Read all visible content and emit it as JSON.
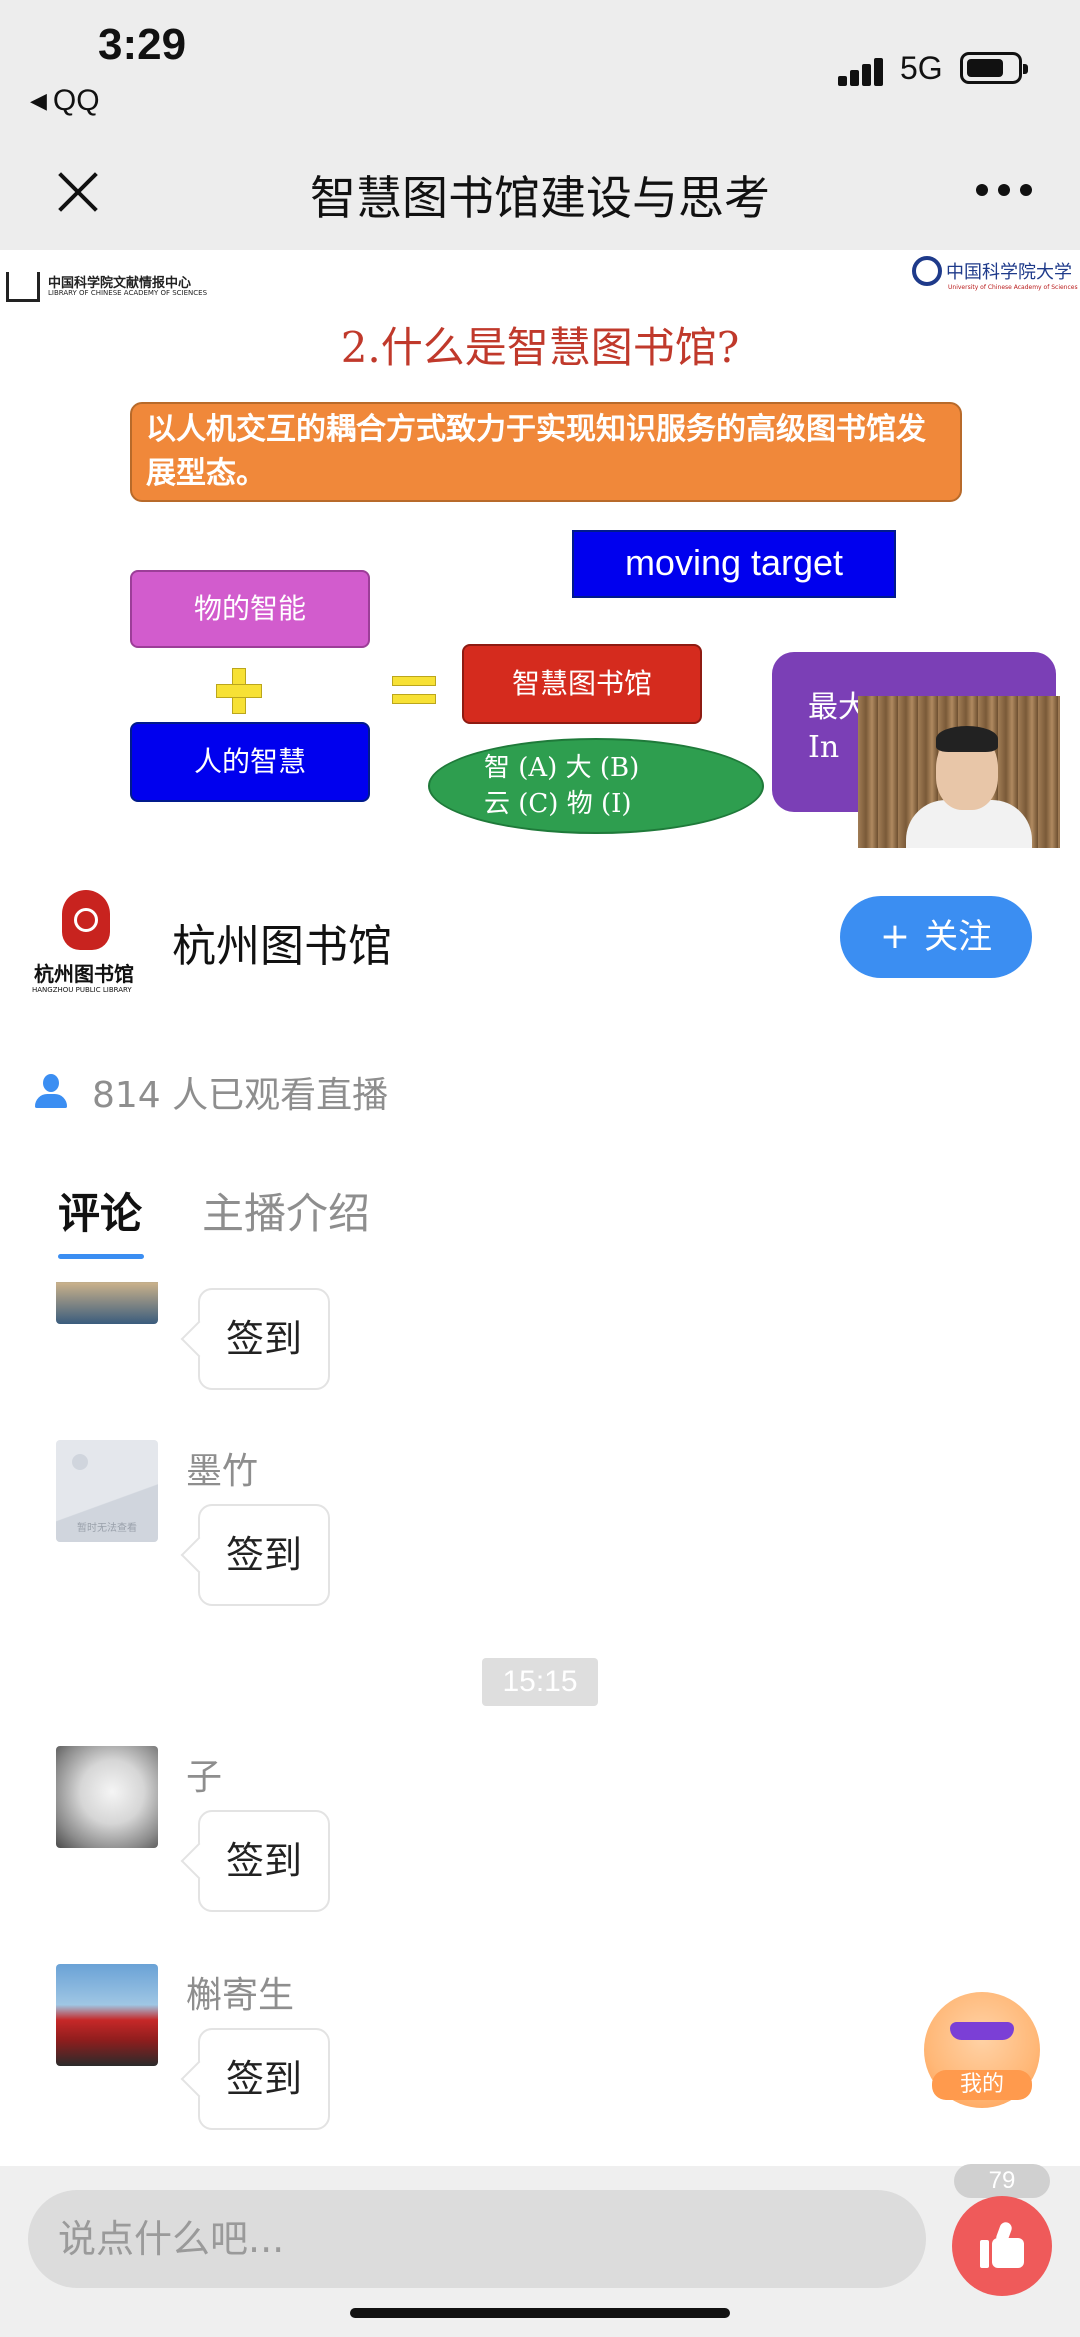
{
  "status_bar": {
    "time": "3:29",
    "back_app": "QQ",
    "network": "5G"
  },
  "nav": {
    "title": "智慧图书馆建设与思考"
  },
  "slide": {
    "logo_left_cn": "中国科学院文献情报中心",
    "logo_left_en": "LIBRARY OF CHINESE ACADEMY OF SCIENCES",
    "logo_right_cn": "中国科学院大学",
    "logo_right_en": "University of Chinese Academy of Sciences",
    "title": "2.什么是智慧图书馆?",
    "definition": "以人机交互的耦合方式致力于实现知识服务的高级图书馆发展型态。",
    "target": "moving target",
    "thing_intelligence": "物的智能",
    "human_wisdom": "人的智慧",
    "result": "智慧图书馆",
    "ellipse_line1": "智 (A) 大 (B)",
    "ellipse_line2": "云 (C) 物 (I)",
    "purple_line1": "最大",
    "purple_line2": "In"
  },
  "profile": {
    "logo_cn": "杭州图书馆",
    "logo_en": "HANGZHOU PUBLIC LIBRARY",
    "name": "杭州图书馆",
    "follow_label": "关注"
  },
  "viewers": {
    "text": "814 人已观看直播"
  },
  "tabs": [
    {
      "label": "评论"
    },
    {
      "label": "主播介绍"
    }
  ],
  "comments": [
    {
      "name": "",
      "message": "签到"
    },
    {
      "name": "墨竹",
      "message": "签到",
      "avatar_caption": "暂时无法查看"
    },
    {
      "name": "子",
      "message": "签到"
    },
    {
      "name": "槲寄生",
      "message": "签到"
    }
  ],
  "time_divider": "15:15",
  "mine_label": "我的",
  "input": {
    "placeholder": "说点什么吧..."
  },
  "like_count": "79",
  "colors": {
    "accent": "#3b8ef2",
    "like": "#ef5a5a",
    "title_red": "#c0392b"
  },
  "icons": [
    "close-icon",
    "more-icon",
    "user-icon",
    "plus-icon",
    "like-icon",
    "signal-icon",
    "battery-icon"
  ]
}
